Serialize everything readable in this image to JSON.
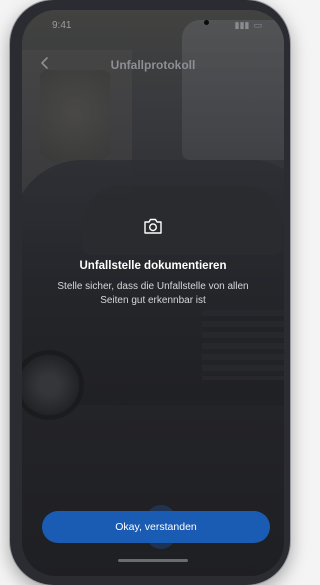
{
  "status_bar": {
    "time": "9:41",
    "signal": "▮▮▮",
    "battery": "▭"
  },
  "header": {
    "back_icon": "chevron-left-icon",
    "title": "Unfallprotokoll"
  },
  "content": {
    "icon": "camera-icon",
    "heading": "Unfallstelle dokumentieren",
    "description": "Stelle sicher, dass die Unfallstelle von allen Seiten gut erkennbar ist"
  },
  "cta": {
    "label": "Okay, verstanden",
    "color": "#1a5bb3"
  }
}
